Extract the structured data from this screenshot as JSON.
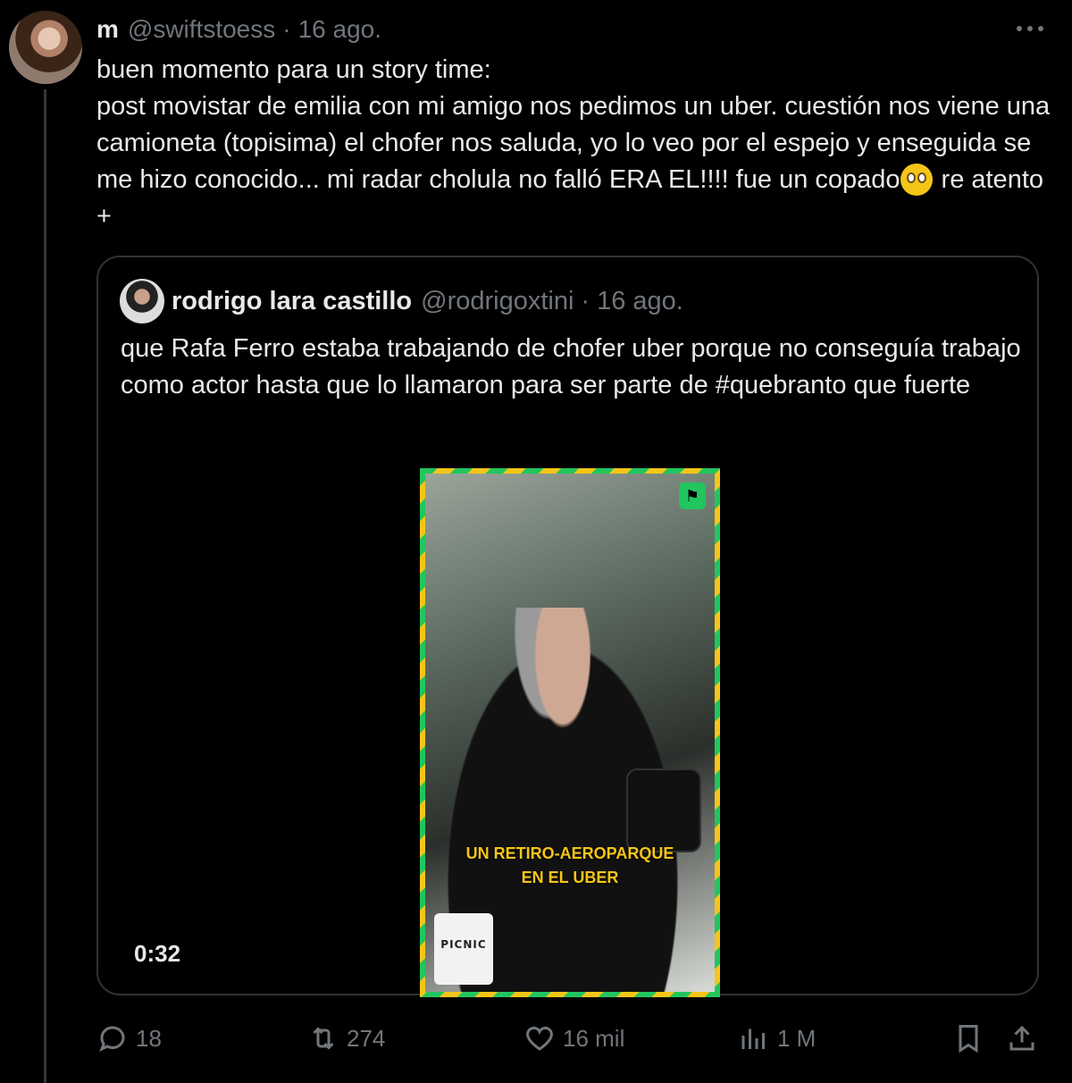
{
  "tweet": {
    "display_name": "m",
    "handle": "@swiftstoess",
    "separator": "·",
    "date": "16 ago.",
    "text": "buen momento para un story time:\npost movistar de emilia con mi amigo nos pedimos un uber. cuestión nos viene una camioneta (topisima) el chofer nos saluda, yo lo veo por el espejo y enseguida se me hizo conocido... mi radar cholula no falló ERA EL!!!! fue un copado",
    "text_after_emoji": "re atento +",
    "emoji": "pleading-face-emoji"
  },
  "quote": {
    "display_name": "rodrigo lara castillo",
    "handle": "@rodrigoxtini",
    "separator": "·",
    "date": "16 ago.",
    "text": "que Rafa Ferro estaba trabajando de chofer uber porque no conseguía trabajo como actor hasta que lo llamaron para ser parte de #quebranto que fuerte",
    "video": {
      "caption": "UN RETIRO-AEROPARQUE\nEN EL UBER",
      "mug_text": "PICNIC",
      "duration": "0:32"
    }
  },
  "actions": {
    "replies": "18",
    "reposts": "274",
    "likes": "16 mil",
    "views": "1 M"
  },
  "colors": {
    "background": "#000000",
    "text": "#e7e9ea",
    "muted": "#71767b",
    "border": "#2f3336",
    "video_border_green": "#22c55e",
    "video_border_yellow": "#f5c518"
  }
}
